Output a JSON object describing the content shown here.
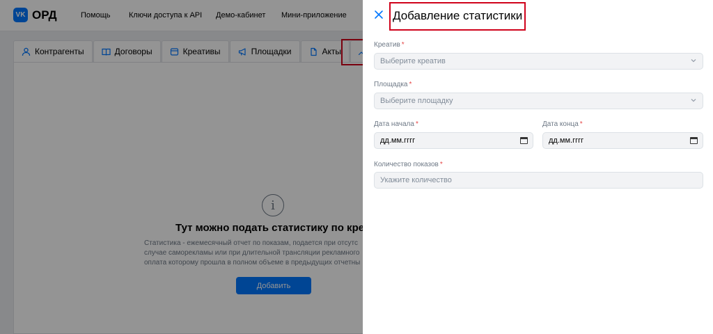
{
  "app": {
    "logo_badge": "VK",
    "logo_text": "ОРД"
  },
  "topnav": [
    "Помощь",
    "Ключи доступа к API",
    "Демо-кабинет",
    "Мини-приложение"
  ],
  "tabs": [
    "Контрагенты",
    "Договоры",
    "Креативы",
    "Площадки",
    "Акты"
  ],
  "empty_state": {
    "icon": "info-icon",
    "title": "Тут можно подать статистику по креатива",
    "desc_lines": [
      "Статистика - ежемесячный отчет по показам, подается при отсутс",
      "случае саморекламы или при длительной трансляции рекламного",
      "оплата которому прошла в полном объеме в предыдущих отчетны"
    ],
    "add_button": "Добавить"
  },
  "drawer": {
    "title": "Добавление статистики",
    "close_icon": "close-icon",
    "fields": {
      "creative": {
        "label": "Креатив",
        "required": "*",
        "placeholder": "Выберите креатив"
      },
      "platform": {
        "label": "Площадка",
        "required": "*",
        "placeholder": "Выберите площадку"
      },
      "date_start": {
        "label": "Дата начала",
        "required": "*",
        "value": "дд.мм.гггг"
      },
      "date_end": {
        "label": "Дата конца",
        "required": "*",
        "value": "дд.мм.гггг"
      },
      "impressions": {
        "label": "Количество показов",
        "required": "*",
        "placeholder": "Укажите количество"
      }
    }
  },
  "colors": {
    "accent": "#0077ff",
    "highlight": "#d0021b",
    "required": "#e64646"
  }
}
